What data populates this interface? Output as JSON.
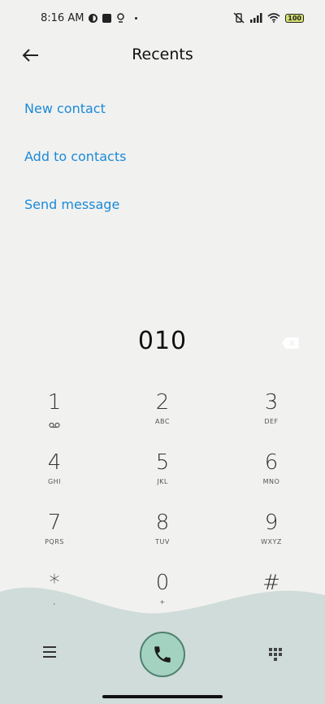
{
  "status_bar": {
    "time": "8:16 AM",
    "battery": "100"
  },
  "header": {
    "title": "Recents",
    "back_icon": "arrow-left-icon"
  },
  "actions": [
    {
      "label": "New contact"
    },
    {
      "label": "Add to contacts"
    },
    {
      "label": "Send message"
    }
  ],
  "dialer": {
    "number": "010",
    "keys": [
      {
        "digit": "1",
        "sub": "voicemail-icon"
      },
      {
        "digit": "2",
        "sub": "ABC"
      },
      {
        "digit": "3",
        "sub": "DEF"
      },
      {
        "digit": "4",
        "sub": "GHI"
      },
      {
        "digit": "5",
        "sub": "JKL"
      },
      {
        "digit": "6",
        "sub": "MNO"
      },
      {
        "digit": "7",
        "sub": "PQRS"
      },
      {
        "digit": "8",
        "sub": "TUV"
      },
      {
        "digit": "9",
        "sub": "WXYZ"
      },
      {
        "digit": "*",
        "sub": ","
      },
      {
        "digit": "0",
        "sub": "+"
      },
      {
        "digit": "#",
        "sub": ""
      }
    ]
  },
  "colors": {
    "accent": "#1b8ad8",
    "wave": "#cfdcd9",
    "call_button": "#a3d3c0"
  }
}
